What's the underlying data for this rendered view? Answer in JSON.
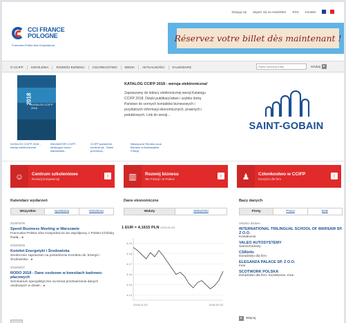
{
  "topbar": {
    "links": [
      "Zaloguj się",
      "Zapisz się na newsletter",
      "RSS",
      "Kontakt"
    ],
    "flag_colors": [
      "#1b3d8f",
      "#ffffff",
      "#d7262b"
    ]
  },
  "logo": {
    "line1": "CCI FRANCE",
    "line2": "POLOGNE",
    "sub": "Francusko-Polska Izba Gospodarcza"
  },
  "banner": {
    "text": "Réservez votre billet dès maintenant !",
    "frame_color": "#5fb3e6"
  },
  "nav": {
    "items": [
      "O CCIFP",
      "SZKOLENIA",
      "ROZWÓJ BIZNESU",
      "CZŁONKOSTWO",
      "MEDIA",
      "AKTUALNOŚCI",
      "KALENDARZ"
    ],
    "search_placeholder": "Wpisz szukaną frazę",
    "search_label": "Szukaj"
  },
  "feature": {
    "year": "2018",
    "cover_caption": "KATALOG CCIFP 2018",
    "title": "KATALOG CCIFP 2018 - wersja elektroniczna!",
    "body": "Zapraszamy do lektury elektronicznej wersji Katalogu CCIFP 2018. Dzięki publikacji łatwo i szybko dotrą Państwo do cennych kontaktów biznesowych i przydatnych informacji ekonomicznych, prawnych i podatkowych. Link do wersji..."
  },
  "sponsor": {
    "name": "SAINT-GOBAIN",
    "color": "#1b4f93"
  },
  "teasers": [
    "KATALOG CCIFP 2018 - wersja elektroniczna!",
    "INKUBATOR CCIFP - atrakcyjne biura i stanowiska...",
    "CCIFP partnerem konferencji - Świat przemocy...",
    "Nieoryczne Rendez-vous Biznesu w Ambasadzie Francji"
  ],
  "cta": [
    {
      "title": "Centrum szkoleniowe",
      "sub": "Rozwój kompetencji",
      "icon": "people-icon"
    },
    {
      "title": "Rozwój biznesu",
      "sub": "We Francji i w Polsce",
      "icon": "chart-icon"
    },
    {
      "title": "Członkostwo w CCIFP",
      "sub": "Korzyści dla firm",
      "icon": "members-icon"
    }
  ],
  "calendar": {
    "title": "Kalendarz wydarzeń",
    "tabs": [
      "Wszystkie",
      "Spotkania",
      "Szkolenia"
    ],
    "items": [
      {
        "date": "2018/02/06",
        "title": "Speed Business Meeting w Warszawie",
        "summary": "Francusko-Polska Izba Gospodarcza we współpracy z Polsko-Chińską Radą... ▸"
      },
      {
        "date": "2018/02/06",
        "title": "Komitet Energetyki i Środowiska",
        "summary": "Serdecznie zapraszam na posiedzenie Komitetu ds. Energii i Środowiska... ▸"
      },
      {
        "date": "2018/02/07",
        "title": "RODO 2018 - Dane osobowe w kwestiach kadrowo-płacowych",
        "summary": "Seminarium specjalistyczne na temat przetwarzania danych osobowych w dziale... ▸"
      }
    ]
  },
  "economy": {
    "title": "Dane ekonomiczne",
    "tabs": [
      "Waluty",
      "Wskaźniki"
    ],
    "rate": "1 EUR  =  4,1615 PLN",
    "rate_date": "(2018-02-02)"
  },
  "chart_data": {
    "type": "line",
    "title": "",
    "xlabel": "",
    "ylabel": "",
    "x_tick_labels": [
      "2018-01-03",
      "2018-02-02"
    ],
    "y_ticks": [
      4.14,
      4.15,
      4.16,
      4.17,
      4.18,
      4.19
    ],
    "ylim": [
      4.135,
      4.195
    ],
    "values": [
      4.186,
      4.183,
      4.179,
      4.175,
      4.181,
      4.177,
      4.183,
      4.178,
      4.172,
      4.166,
      4.16,
      4.162,
      4.158,
      4.151,
      4.147,
      4.152,
      4.154,
      4.15,
      4.146,
      4.149,
      4.154,
      4.163
    ],
    "grid": true,
    "line_color": "#555555"
  },
  "database": {
    "title": "Bazy danych",
    "tabs": [
      "Firmy",
      "Praca",
      "B2B"
    ],
    "label": "Ostatnio dodane",
    "items": [
      {
        "name": "INTERNATIONAL TRILINGUAL SCHOOL OF WARSAW SP. Z O.O.",
        "category": "Kształcenie"
      },
      {
        "name": "VALEO AUTOSYSTEMY",
        "category": "Samochodowy"
      },
      {
        "name": "CSRinfo",
        "category": "Doradztwo dla firm"
      },
      {
        "name": "ELEGANZA PALACE SP. Z O.O.",
        "category": "Inne"
      },
      {
        "name": "SCOTWORK POLSKA",
        "category": "Doradztwo dla firm, Kształcenie, Inne"
      }
    ],
    "more_label": "Więcej"
  },
  "accent_color": "#e12a2a"
}
